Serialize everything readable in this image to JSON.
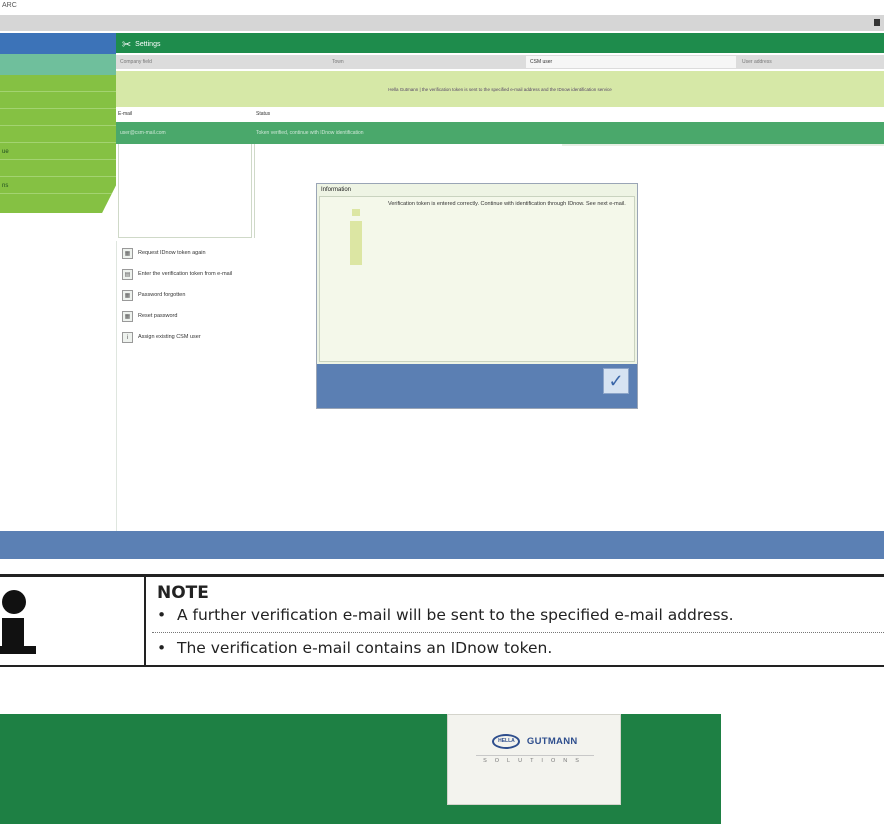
{
  "corner_mark": "ARC",
  "app": {
    "window": {},
    "sidebar": {
      "items": [
        "",
        "",
        "",
        "",
        "ue",
        "",
        "ns",
        ""
      ]
    },
    "settings": {
      "title": "Settings",
      "fields": [
        {
          "label": "Company field"
        },
        {
          "label": "Town"
        },
        {
          "label": "CSM user",
          "active": true
        },
        {
          "label": "User address"
        }
      ],
      "banner_text": "Hella Gutmann | the verification token is sent to the specified e-mail address and the IDnow identification service",
      "table": {
        "headers": [
          "E-mail",
          "Status"
        ],
        "row": [
          "user@csm-mail.com",
          "Token verified, continue with IDnow identification"
        ]
      },
      "actions": [
        {
          "label": "Request IDnow token again",
          "icon": "token-icon"
        },
        {
          "label": "Enter the verification token from e-mail",
          "icon": "mail-icon"
        },
        {
          "label": "Password forgotten",
          "icon": "key-icon"
        },
        {
          "label": "Reset password",
          "icon": "reset-icon"
        },
        {
          "label": "Assign existing CSM user",
          "icon": "user-icon"
        }
      ]
    },
    "dialog": {
      "title": "Information",
      "message": "Verification token is entered correctly. Continue with identification through IDnow. See next e-mail.",
      "ok_icon": "✓"
    }
  },
  "note": {
    "title": "NOTE",
    "bullets": [
      "A further verification e-mail will be sent to the specified e-mail address.",
      "The verification e-mail contains an IDnow token."
    ]
  },
  "footer": {
    "logo_mark": "HELLA",
    "logo_text": "GUTMANN",
    "logo_sub": "SOLUTIONS",
    "colors": {
      "green": "#1e8044",
      "blue": "#2e4e8d"
    }
  }
}
